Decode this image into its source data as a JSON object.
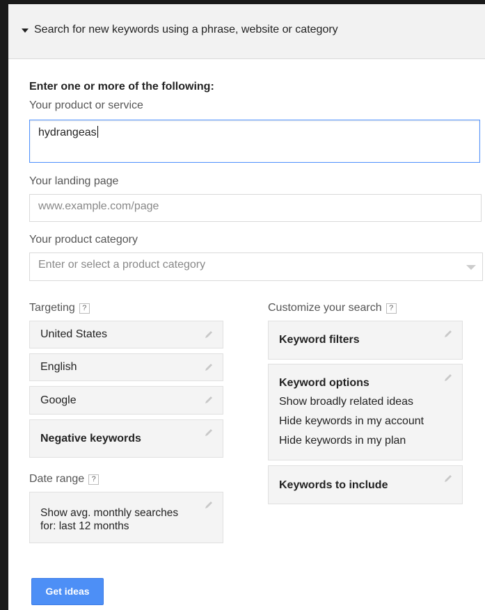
{
  "header": {
    "title": "Search for new keywords using a phrase, website or category"
  },
  "form": {
    "intro": "Enter one or more of the following:",
    "product_label": "Your product or service",
    "product_value": "hydrangeas",
    "landing_label": "Your landing page",
    "landing_placeholder": "www.example.com/page",
    "category_label": "Your product category",
    "category_placeholder": "Enter or select a product category"
  },
  "targeting": {
    "label": "Targeting",
    "help": "?",
    "items": [
      "United States",
      "English",
      "Google"
    ],
    "negative": "Negative keywords"
  },
  "date_range": {
    "label": "Date range",
    "help": "?",
    "line1": "Show avg. monthly searches",
    "line2": "for: last 12 months"
  },
  "customize": {
    "label": "Customize your search",
    "help": "?",
    "filters": "Keyword filters",
    "options_title": "Keyword options",
    "options": [
      "Show broadly related ideas",
      "Hide keywords in my account",
      "Hide keywords in my plan"
    ],
    "include": "Keywords to include"
  },
  "actions": {
    "get_ideas": "Get ideas"
  },
  "colors": {
    "accent": "#4d8ff6",
    "focus_border": "#4d90fe",
    "box_bg": "#f4f4f4"
  }
}
